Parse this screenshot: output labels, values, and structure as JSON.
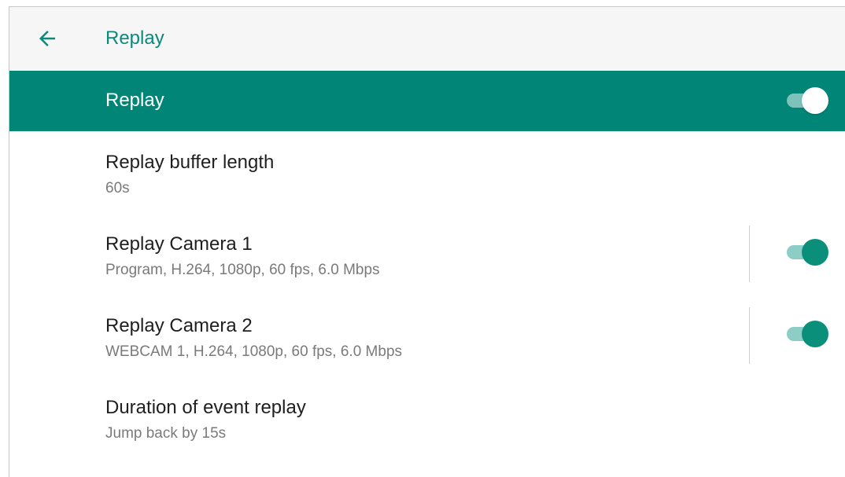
{
  "appbar": {
    "title": "Replay",
    "back_icon": "arrow-left-icon"
  },
  "colors": {
    "accent": "#008577",
    "title_accent": "#0b8a7b",
    "appbar_bg": "#f6f6f6"
  },
  "master_switch": {
    "label": "Replay",
    "checked": true
  },
  "settings": [
    {
      "title": "Replay buffer length",
      "summary": "60s"
    },
    {
      "title": "Replay Camera 1",
      "summary": "Program, H.264, 1080p, 60 fps, 6.0 Mbps",
      "checked": true
    },
    {
      "title": "Replay Camera 2",
      "summary": "WEBCAM 1, H.264, 1080p, 60 fps, 6.0 Mbps",
      "checked": true
    },
    {
      "title": "Duration of event replay",
      "summary": "Jump back by 15s"
    }
  ]
}
